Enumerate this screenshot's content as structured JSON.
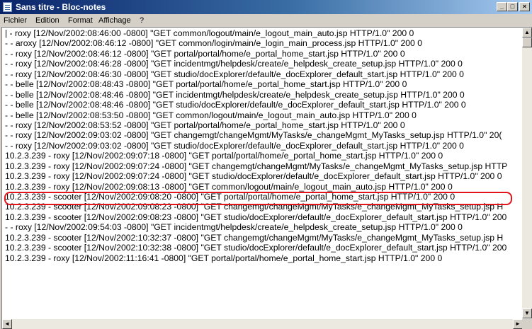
{
  "window": {
    "title": "Sans titre - Bloc-notes",
    "icon": "notepad-icon",
    "controls": {
      "minimize": "_",
      "maximize": "□",
      "close": "×"
    }
  },
  "menu": [
    {
      "label": "Fichier"
    },
    {
      "label": "Edition"
    },
    {
      "label": "Format"
    },
    {
      "label": "Affichage"
    },
    {
      "label": "?"
    }
  ],
  "document": {
    "lines": [
      "| - roxy [12/Nov/2002:08:46:00 -0800] \"GET common/logout/main/e_logout_main_auto.jsp HTTP/1.0\" 200 0",
      "- - aroxy [12/Nov/2002:08:46:12 -0800] \"GET common/login/main/e_login_main_process.jsp HTTP/1.0\" 200 0",
      "- - roxy [12/Nov/2002:08:46:12 -0800] \"GET portal/portal/home/e_portal_home_start.jsp HTTP/1.0\" 200 0",
      "- - roxy [12/Nov/2002:08:46:28 -0800] \"GET incidentmgt/helpdesk/create/e_helpdesk_create_setup.jsp HTTP/1.0\" 200 0",
      "- - roxy [12/Nov/2002:08:46:30 -0800] \"GET studio/docExplorer/default/e_docExplorer_default_start.jsp HTTP/1.0\" 200 0",
      "- - belle [12/Nov/2002:08:48:43 -0800] \"GET portal/portal/home/e_portal_home_start.jsp HTTP/1.0\" 200 0",
      "- - belle [12/Nov/2002:08:48:46 -0800] \"GET incidentmgt/helpdesk/create/e_helpdesk_create_setup.jsp HTTP/1.0\" 200 0",
      "- - belle [12/Nov/2002:08:48:46 -0800] \"GET studio/docExplorer/default/e_docExplorer_default_start.jsp HTTP/1.0\" 200 0",
      "- - belle [12/Nov/2002:08:53:50 -0800] \"GET common/logout/main/e_logout_main_auto.jsp HTTP/1.0\" 200 0",
      "- - roxy [12/Nov/2002:08:53:52 -0800] \"GET portal/portal/home/e_portal_home_start.jsp HTTP/1.0\" 200 0",
      "- - roxy [12/Nov/2002:09:03:02 -0800] \"GET changemgt/changeMgmt/MyTasks/e_changeMgmt_MyTasks_setup.jsp HTTP/1.0\" 20(",
      "- - roxy [12/Nov/2002:09:03:02 -0800] \"GET studio/docExplorer/default/e_docExplorer_default_start.jsp HTTP/1.0\" 200 0",
      "10.2.3.239 - roxy [12/Nov/2002:09:07:18 -0800] \"GET portal/portal/home/e_portal_home_start.jsp HTTP/1.0\" 200 0",
      "10.2.3.239 - roxy [12/Nov/2002:09:07:24 -0800] \"GET changemgt/changeMgmt/MyTasks/e_changeMgmt_MyTasks_setup.jsp HTTP",
      "10.2.3.239 - roxy [12/Nov/2002:09:07:24 -0800] \"GET studio/docExplorer/default/e_docExplorer_default_start.jsp HTTP/1.0\" 200 0",
      "10.2.3.239 - roxy [12/Nov/2002:09:08:13 -0800] \"GET common/logout/main/e_logout_main_auto.jsp HTTP/1.0\" 200 0",
      "10.2.3.239 - scooter [12/Nov/2002:09:08:20 -0800] \"GET portal/portal/home/e_portal_home_start.jsp HTTP/1.0\" 200 0",
      "10.2.3.239 - scooter [12/Nov/2002:09:08:23 -0800] \"GET changemgt/changeMgmt/MyTasks/e_changeMgmt_MyTasks_setup.jsp H",
      "10.2.3.239 - scooter [12/Nov/2002:09:08:23 -0800] \"GET studio/docExplorer/default/e_docExplorer_default_start.jsp HTTP/1.0\" 200",
      "- - roxy [12/Nov/2002:09:54:03 -0800] \"GET incidentmgt/helpdesk/create/e_helpdesk_create_setup.jsp HTTP/1.0\" 200 0",
      "10.2.3.239 - scooter [12/Nov/2002:10:32:37 -0800] \"GET changemgt/changeMgmt/MyTasks/e_changeMgmt_MyTasks_setup.jsp H",
      "10.2.3.239 - scooter [12/Nov/2002:10:32:38 -0800] \"GET studio/docExplorer/default/e_docExplorer_default_start.jsp HTTP/1.0\" 200",
      "10.2.3.239 - roxy [12/Nov/2002:11:16:41 -0800] \"GET portal/portal/home/e_portal_home_start.jsp HTTP/1.0\" 200 0"
    ],
    "highlighted_line_index": 12,
    "highlight_color": "#e4141b"
  },
  "scrollbars": {
    "up_arrow": "▲",
    "down_arrow": "▼",
    "left_arrow": "◄",
    "right_arrow": "►"
  }
}
